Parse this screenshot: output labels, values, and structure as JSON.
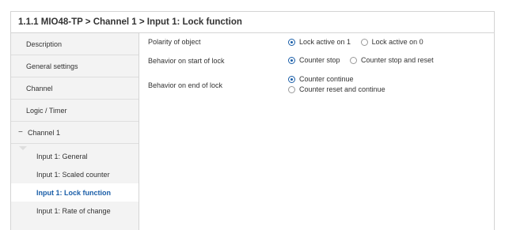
{
  "header": {
    "breadcrumb": "1.1.1 MIO48-TP > Channel 1 > Input 1: Lock function"
  },
  "sidebar": {
    "items": [
      {
        "label": "Description"
      },
      {
        "label": "General settings"
      },
      {
        "label": "Channel"
      },
      {
        "label": "Logic / Timer"
      }
    ],
    "group": {
      "toggle": "−",
      "label": "Channel 1",
      "children": [
        {
          "label": "Input 1: General"
        },
        {
          "label": "Input 1: Scaled counter"
        },
        {
          "label": "Input 1: Lock function"
        },
        {
          "label": "Input 1: Rate of change"
        }
      ],
      "active_index": 2
    }
  },
  "params": [
    {
      "label": "Polarity of object",
      "options": [
        "Lock active on 1",
        "Lock active on 0"
      ],
      "selected": 0
    },
    {
      "label": "Behavior on start of lock",
      "options": [
        "Counter stop",
        "Counter stop and reset"
      ],
      "selected": 0
    },
    {
      "label": "Behavior on end of lock",
      "options": [
        "Counter continue",
        "Counter reset and continue"
      ],
      "selected": 0
    }
  ],
  "colors": {
    "accent": "#1a5ea8",
    "sidebar_bg": "#f3f3f3",
    "border": "#d4d4d4"
  }
}
